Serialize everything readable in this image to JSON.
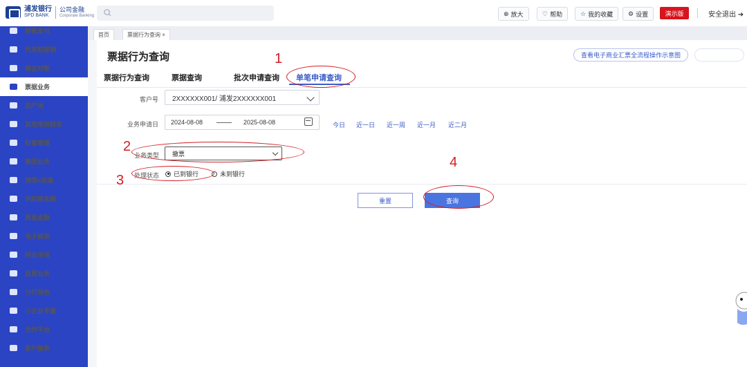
{
  "brand": {
    "name_cn": "浦发银行",
    "name_en": "SPD BANK",
    "division_cn": "公司金融",
    "division_en": "Corporate Banking"
  },
  "header": {
    "tools": [
      {
        "label": "放大",
        "icon": "zoom-icon"
      },
      {
        "label": "帮助",
        "icon": "help-icon"
      },
      {
        "label": "我的收藏",
        "icon": "star-icon"
      },
      {
        "label": "设置",
        "icon": "gear-icon"
      }
    ],
    "demo": "演示版",
    "logout": "安全退出"
  },
  "sidebar": {
    "items": [
      {
        "label": "转账支付"
      },
      {
        "label": "代发和报销"
      },
      {
        "label": "银企对账"
      },
      {
        "label": "票据业务",
        "active": true
      },
      {
        "label": "资产池"
      },
      {
        "label": "其他常用财务"
      },
      {
        "label": "财富管理"
      },
      {
        "label": "集团业务"
      },
      {
        "label": "跨境e站通"
      },
      {
        "label": "供应链金融"
      },
      {
        "label": "贸易金融"
      },
      {
        "label": "电子商务"
      },
      {
        "label": "同业市场"
      },
      {
        "label": "自贸业务"
      },
      {
        "label": "分行特色"
      },
      {
        "label": "小企业专属"
      },
      {
        "label": "合作平台"
      },
      {
        "label": "客户服务"
      }
    ]
  },
  "tabs": {
    "home": "首页",
    "current": "票据行为查询"
  },
  "page": {
    "title": "票据行为查询",
    "top_link": "查看电子商业汇票全流程操作示意图",
    "subtabs": [
      "票据行为查询",
      "票据查询",
      "批次申请查询",
      "单笔申请查询"
    ]
  },
  "form": {
    "customer_label": "客户号",
    "customer_value": "2XXXXXX001/ 浦发2XXXXXX001",
    "date_label": "业务申请日",
    "date_from": "2024-08-08",
    "date_to": "2025-08-08",
    "quick_ranges": [
      "今日",
      "近一日",
      "近一周",
      "近一月",
      "近二月"
    ],
    "biz_type_label": "业务类型",
    "biz_type_value": "撤票",
    "status_label": "处理状态",
    "status_options": [
      {
        "label": "已到银行",
        "checked": true
      },
      {
        "label": "未到银行",
        "checked": false
      }
    ],
    "reset": "重置",
    "query": "查询"
  },
  "annotations": [
    "1",
    "2",
    "3",
    "4"
  ],
  "colors": {
    "sidebar": "#2a44c4",
    "accent": "#3b5cc8",
    "annotation": "#d21c22",
    "demo": "#d8141c"
  }
}
